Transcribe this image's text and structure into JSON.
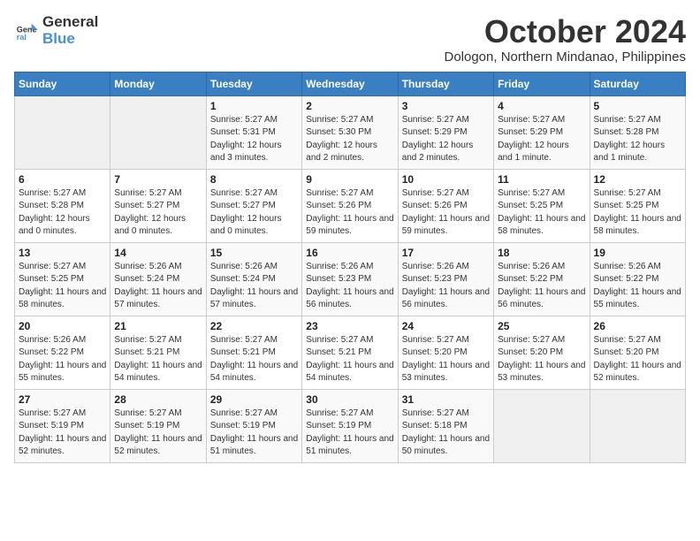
{
  "header": {
    "logo_line1": "General",
    "logo_line2": "Blue",
    "month": "October 2024",
    "location": "Dologon, Northern Mindanao, Philippines"
  },
  "days_of_week": [
    "Sunday",
    "Monday",
    "Tuesday",
    "Wednesday",
    "Thursday",
    "Friday",
    "Saturday"
  ],
  "weeks": [
    [
      {
        "day": "",
        "info": ""
      },
      {
        "day": "",
        "info": ""
      },
      {
        "day": "1",
        "info": "Sunrise: 5:27 AM\nSunset: 5:31 PM\nDaylight: 12 hours and 3 minutes."
      },
      {
        "day": "2",
        "info": "Sunrise: 5:27 AM\nSunset: 5:30 PM\nDaylight: 12 hours and 2 minutes."
      },
      {
        "day": "3",
        "info": "Sunrise: 5:27 AM\nSunset: 5:29 PM\nDaylight: 12 hours and 2 minutes."
      },
      {
        "day": "4",
        "info": "Sunrise: 5:27 AM\nSunset: 5:29 PM\nDaylight: 12 hours and 1 minute."
      },
      {
        "day": "5",
        "info": "Sunrise: 5:27 AM\nSunset: 5:28 PM\nDaylight: 12 hours and 1 minute."
      }
    ],
    [
      {
        "day": "6",
        "info": "Sunrise: 5:27 AM\nSunset: 5:28 PM\nDaylight: 12 hours and 0 minutes."
      },
      {
        "day": "7",
        "info": "Sunrise: 5:27 AM\nSunset: 5:27 PM\nDaylight: 12 hours and 0 minutes."
      },
      {
        "day": "8",
        "info": "Sunrise: 5:27 AM\nSunset: 5:27 PM\nDaylight: 12 hours and 0 minutes."
      },
      {
        "day": "9",
        "info": "Sunrise: 5:27 AM\nSunset: 5:26 PM\nDaylight: 11 hours and 59 minutes."
      },
      {
        "day": "10",
        "info": "Sunrise: 5:27 AM\nSunset: 5:26 PM\nDaylight: 11 hours and 59 minutes."
      },
      {
        "day": "11",
        "info": "Sunrise: 5:27 AM\nSunset: 5:25 PM\nDaylight: 11 hours and 58 minutes."
      },
      {
        "day": "12",
        "info": "Sunrise: 5:27 AM\nSunset: 5:25 PM\nDaylight: 11 hours and 58 minutes."
      }
    ],
    [
      {
        "day": "13",
        "info": "Sunrise: 5:27 AM\nSunset: 5:25 PM\nDaylight: 11 hours and 58 minutes."
      },
      {
        "day": "14",
        "info": "Sunrise: 5:26 AM\nSunset: 5:24 PM\nDaylight: 11 hours and 57 minutes."
      },
      {
        "day": "15",
        "info": "Sunrise: 5:26 AM\nSunset: 5:24 PM\nDaylight: 11 hours and 57 minutes."
      },
      {
        "day": "16",
        "info": "Sunrise: 5:26 AM\nSunset: 5:23 PM\nDaylight: 11 hours and 56 minutes."
      },
      {
        "day": "17",
        "info": "Sunrise: 5:26 AM\nSunset: 5:23 PM\nDaylight: 11 hours and 56 minutes."
      },
      {
        "day": "18",
        "info": "Sunrise: 5:26 AM\nSunset: 5:22 PM\nDaylight: 11 hours and 56 minutes."
      },
      {
        "day": "19",
        "info": "Sunrise: 5:26 AM\nSunset: 5:22 PM\nDaylight: 11 hours and 55 minutes."
      }
    ],
    [
      {
        "day": "20",
        "info": "Sunrise: 5:26 AM\nSunset: 5:22 PM\nDaylight: 11 hours and 55 minutes."
      },
      {
        "day": "21",
        "info": "Sunrise: 5:27 AM\nSunset: 5:21 PM\nDaylight: 11 hours and 54 minutes."
      },
      {
        "day": "22",
        "info": "Sunrise: 5:27 AM\nSunset: 5:21 PM\nDaylight: 11 hours and 54 minutes."
      },
      {
        "day": "23",
        "info": "Sunrise: 5:27 AM\nSunset: 5:21 PM\nDaylight: 11 hours and 54 minutes."
      },
      {
        "day": "24",
        "info": "Sunrise: 5:27 AM\nSunset: 5:20 PM\nDaylight: 11 hours and 53 minutes."
      },
      {
        "day": "25",
        "info": "Sunrise: 5:27 AM\nSunset: 5:20 PM\nDaylight: 11 hours and 53 minutes."
      },
      {
        "day": "26",
        "info": "Sunrise: 5:27 AM\nSunset: 5:20 PM\nDaylight: 11 hours and 52 minutes."
      }
    ],
    [
      {
        "day": "27",
        "info": "Sunrise: 5:27 AM\nSunset: 5:19 PM\nDaylight: 11 hours and 52 minutes."
      },
      {
        "day": "28",
        "info": "Sunrise: 5:27 AM\nSunset: 5:19 PM\nDaylight: 11 hours and 52 minutes."
      },
      {
        "day": "29",
        "info": "Sunrise: 5:27 AM\nSunset: 5:19 PM\nDaylight: 11 hours and 51 minutes."
      },
      {
        "day": "30",
        "info": "Sunrise: 5:27 AM\nSunset: 5:19 PM\nDaylight: 11 hours and 51 minutes."
      },
      {
        "day": "31",
        "info": "Sunrise: 5:27 AM\nSunset: 5:18 PM\nDaylight: 11 hours and 50 minutes."
      },
      {
        "day": "",
        "info": ""
      },
      {
        "day": "",
        "info": ""
      }
    ]
  ]
}
